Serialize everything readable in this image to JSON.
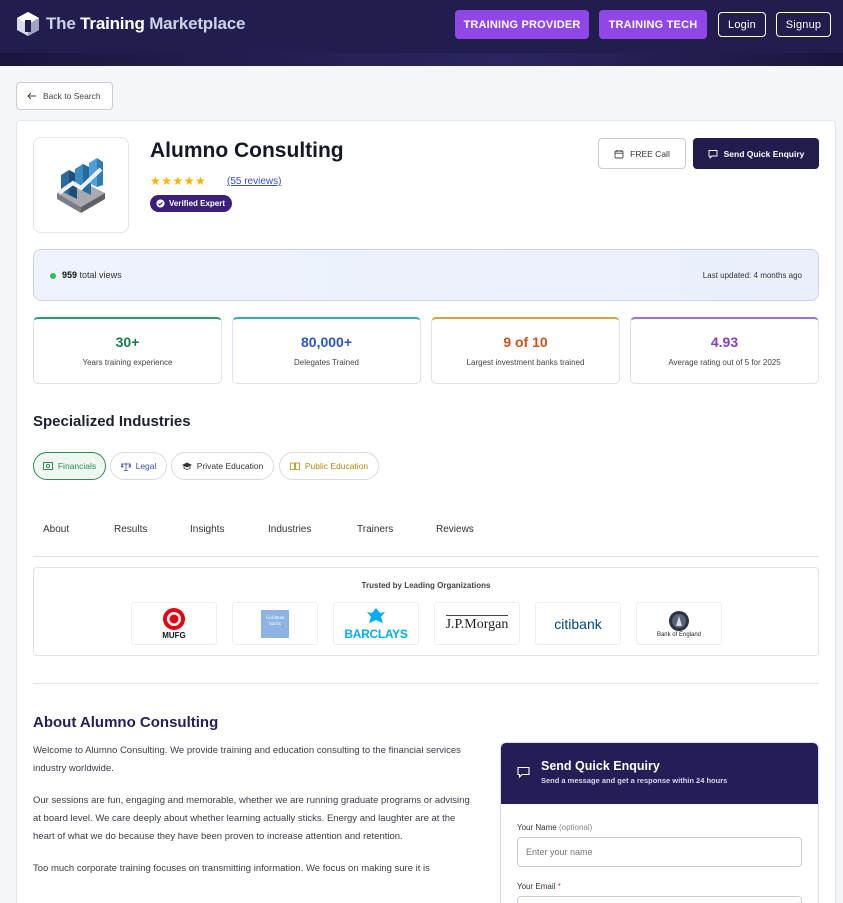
{
  "header": {
    "brand_prefix": "The ",
    "brand_main": "Training",
    "brand_suffix": " Marketplace",
    "nav": {
      "training_provider": "TRAINING PROVIDER",
      "training_tech": "TRAINING TECH",
      "login": "Login",
      "signup": "Signup"
    }
  },
  "back_label": "Back to Search",
  "profile": {
    "name": "Alumno Consulting",
    "stars": "★★★★★",
    "reviews_link": "(55 reviews)",
    "verified_label": "Verified Expert",
    "free_call_label": "FREE Call",
    "enquiry_label": "Send Quick Enquiry"
  },
  "views": {
    "count": "959",
    "suffix": "total views",
    "updated_label": "Last updated:",
    "updated_value": "4 months ago"
  },
  "stats": [
    {
      "value": "30+",
      "label": "Years training experience",
      "color": "#1b7a4d"
    },
    {
      "value": "80,000+",
      "label": "Delegates Trained",
      "color": "#2a56c6"
    },
    {
      "value": "9 of 10",
      "label": "Largest investment banks trained",
      "color": "#c8531c"
    },
    {
      "value": "4.93",
      "label": "Average rating out of 5 for 2025",
      "color": "#7b3fd6"
    }
  ],
  "industries": {
    "title": "Specialized Industries",
    "chips": [
      {
        "label": "Financials",
        "color": "#2f8a55",
        "icon": "banknote-icon"
      },
      {
        "label": "Legal",
        "color": "#3a4fa8",
        "icon": "scales-icon"
      },
      {
        "label": "Private Education",
        "color": "#333333",
        "icon": "graduation-cap-icon"
      },
      {
        "label": "Public Education",
        "color": "#b38a12",
        "icon": "book-icon"
      }
    ]
  },
  "tabs": [
    "About",
    "Results",
    "Insights",
    "Industries",
    "Trainers",
    "Reviews"
  ],
  "trusted": {
    "title": "Trusted by Leading Organizations",
    "orgs": [
      {
        "name": "MUFG"
      },
      {
        "name": "Goldman Sachs"
      },
      {
        "name": "BARCLAYS"
      },
      {
        "name": "J.P.Morgan"
      },
      {
        "name": "citibank"
      },
      {
        "name": "Bank of England"
      }
    ]
  },
  "about": {
    "title": "About Alumno Consulting",
    "paragraphs": [
      "Welcome to Alumno Consulting. We provide training and education consulting to the financial services industry worldwide.",
      "Our sessions are fun, engaging and memorable, whether we are running graduate programs or advising at board level. We care deeply about whether learning actually sticks. Energy and laughter are at the heart of what we do because they have been proven to increase attention and retention.",
      "Too much corporate training focuses on transmitting information. We focus on making sure it is"
    ]
  },
  "form": {
    "title": "Send Quick Enquiry",
    "subtitle": "Send a message and get a response within 24 hours",
    "name_label": "Your Name",
    "name_optional": "(optional)",
    "name_placeholder": "Enter your name",
    "email_label": "Your Email",
    "email_required": "*"
  },
  "colors": {
    "header_bg": "#221d4f",
    "accent_purple": "#9146e8",
    "primary_dark": "#211c4e"
  }
}
